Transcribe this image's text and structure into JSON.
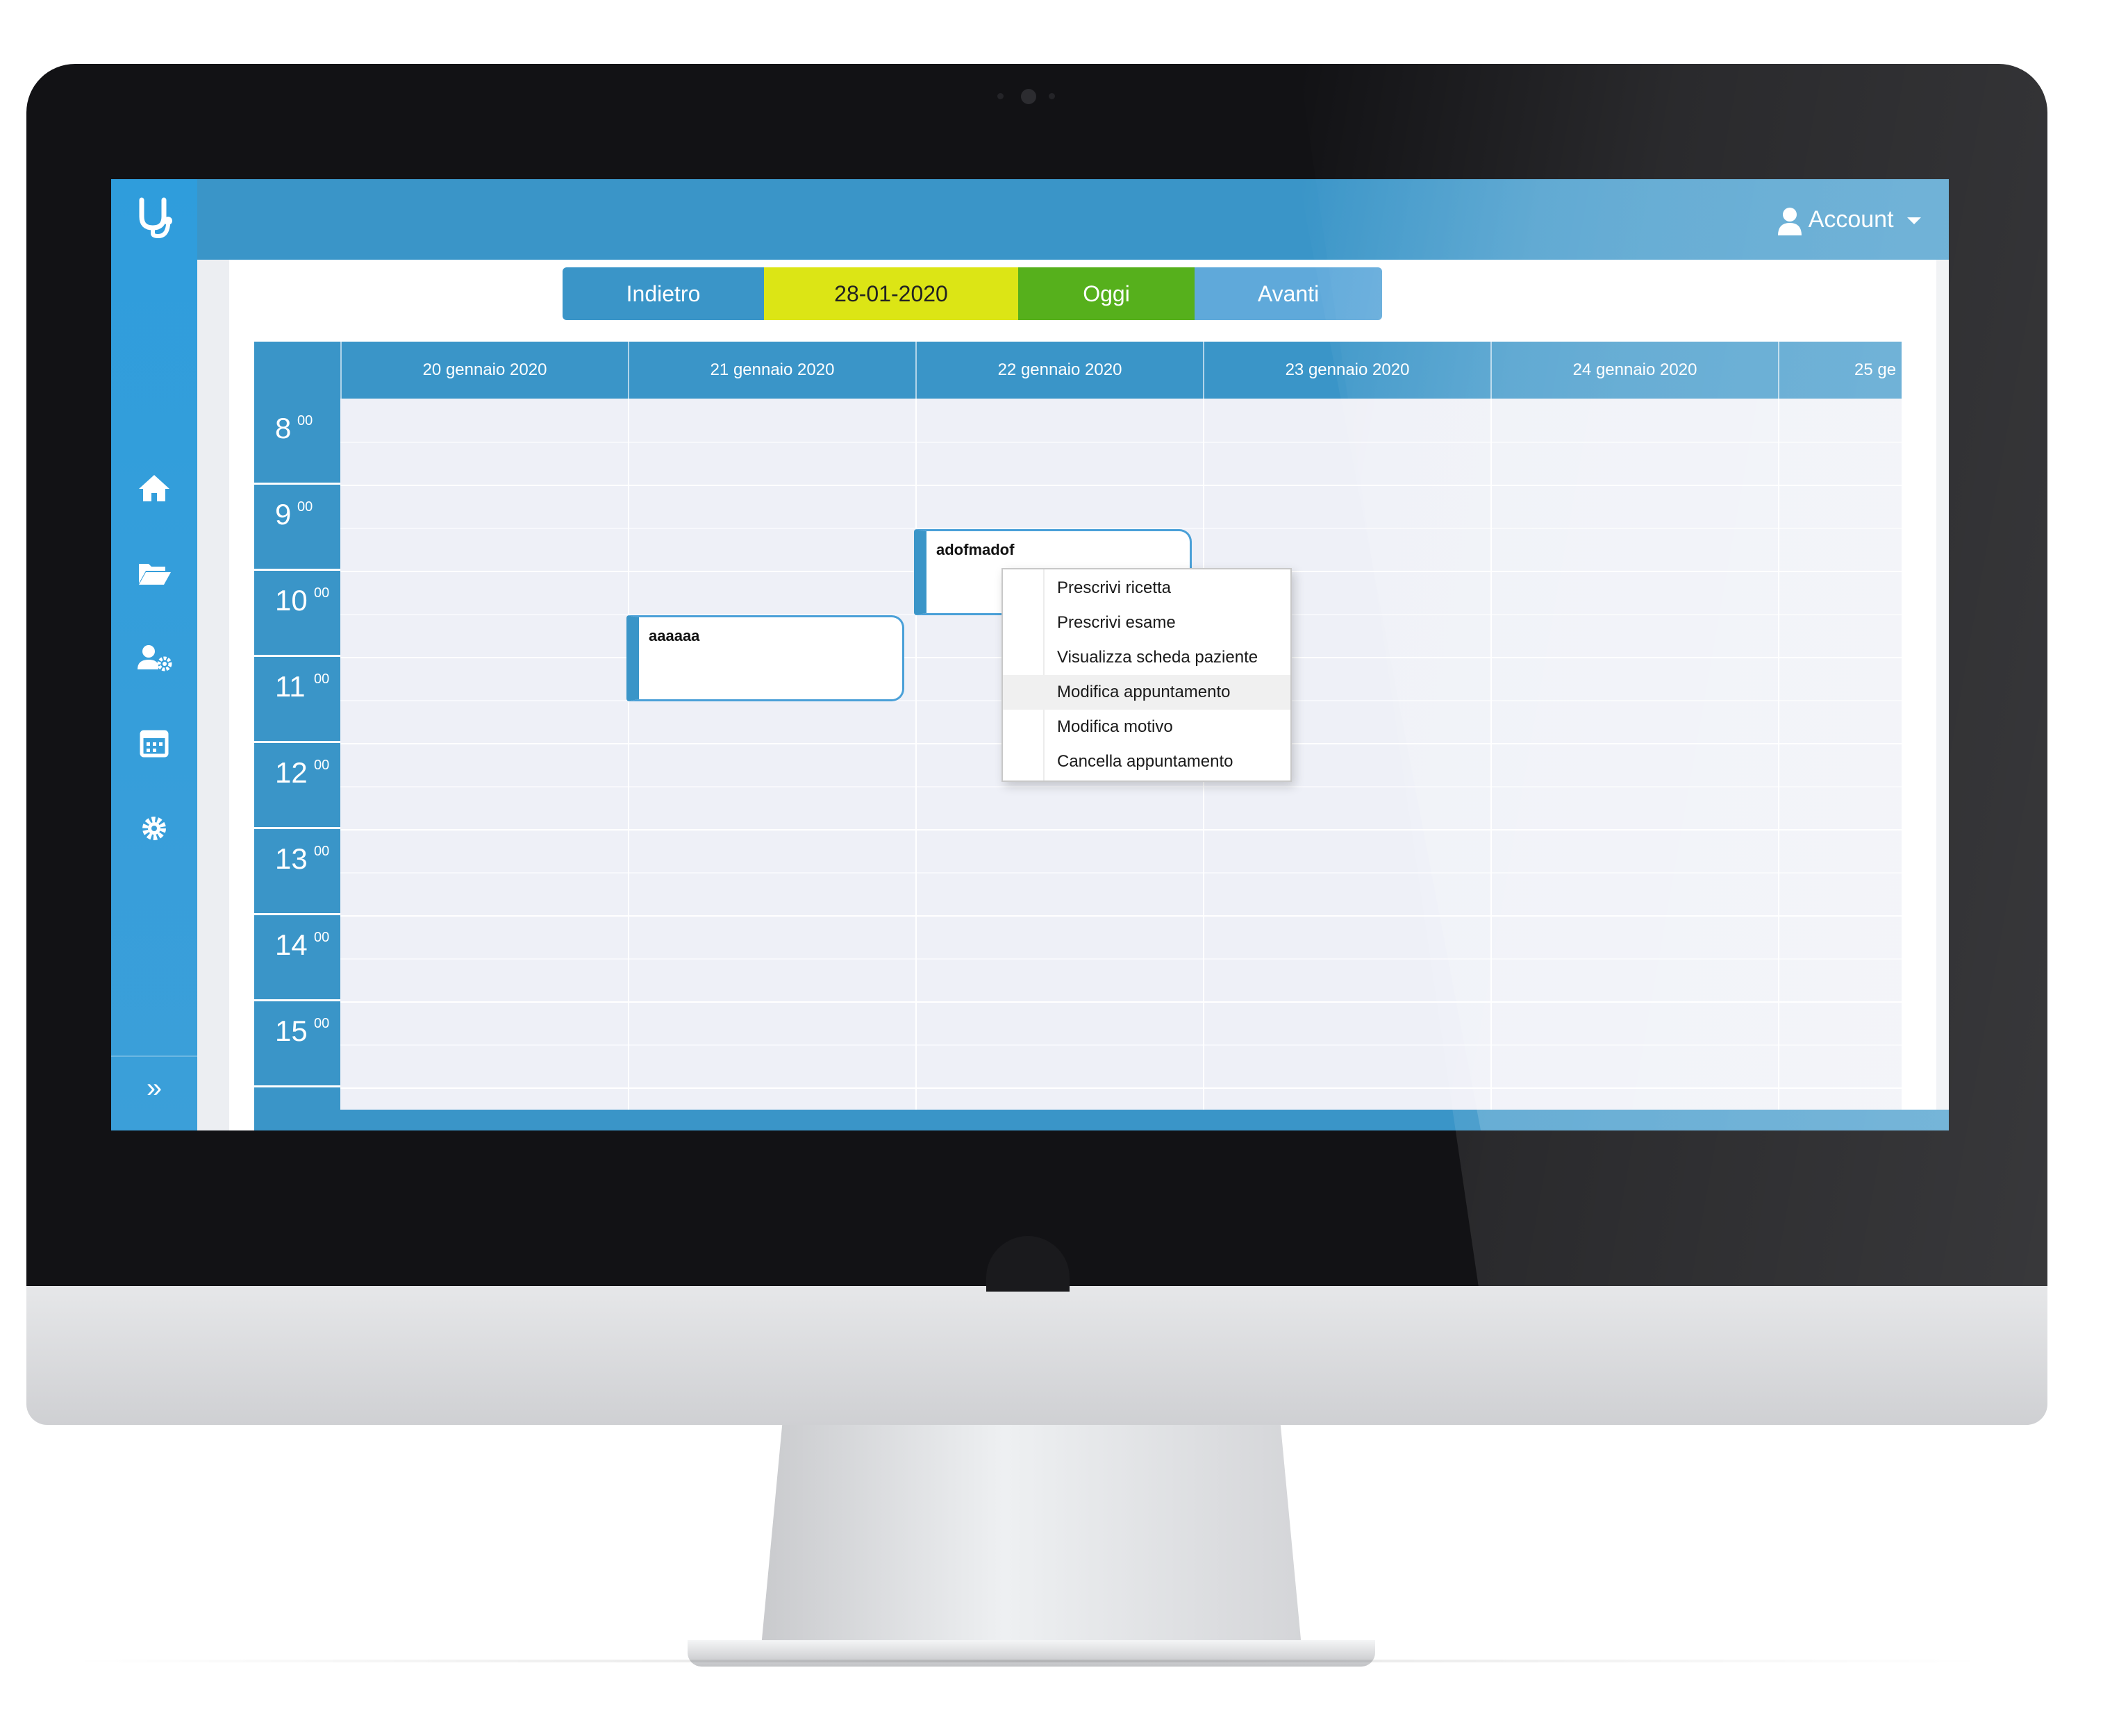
{
  "topbar": {
    "account_label": "Account"
  },
  "sidebar": {
    "logo": "ψ",
    "items": [
      {
        "icon": "home-icon"
      },
      {
        "icon": "folder-open-icon"
      },
      {
        "icon": "user-settings-icon"
      },
      {
        "icon": "calendar-icon"
      },
      {
        "icon": "gear-icon"
      }
    ],
    "expand_label": "»"
  },
  "nav": {
    "back_label": "Indietro",
    "current_date": "28-01-2020",
    "today_label": "Oggi",
    "next_label": "Avanti"
  },
  "calendar": {
    "days": [
      "20 gennaio 2020",
      "21 gennaio 2020",
      "22 gennaio 2020",
      "23 gennaio 2020",
      "24 gennaio 2020",
      "25 ge"
    ],
    "hours": [
      {
        "h": "8",
        "m": "00"
      },
      {
        "h": "9",
        "m": "00"
      },
      {
        "h": "10",
        "m": "00"
      },
      {
        "h": "11",
        "m": "00"
      },
      {
        "h": "12",
        "m": "00"
      },
      {
        "h": "13",
        "m": "00"
      },
      {
        "h": "14",
        "m": "00"
      },
      {
        "h": "15",
        "m": "00"
      }
    ],
    "appointments": [
      {
        "title": "aaaaaa",
        "day": "21 gennaio 2020",
        "start": "10:30",
        "end": "11:30"
      },
      {
        "title": "adofmadof",
        "day": "22 gennaio 2020",
        "start": "9:30",
        "end": "10:30"
      }
    ]
  },
  "context_menu": {
    "items": [
      "Prescrivi ricetta",
      "Prescrivi esame",
      "Visualizza scheda paziente",
      "Modifica appuntamento",
      "Modifica motivo",
      "Cancella appuntamento"
    ],
    "highlighted": "Modifica appuntamento"
  },
  "colors": {
    "primary": "#3a95c8",
    "sidebar": "#2f9ddc",
    "back_button": "#3a95c8",
    "date_button": "#dce515",
    "today_button": "#56b01c",
    "next_button": "#5fa9da"
  }
}
